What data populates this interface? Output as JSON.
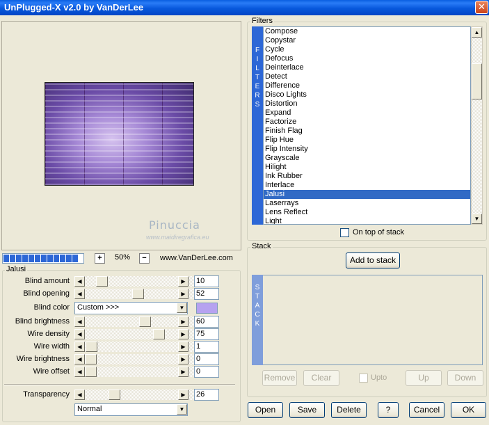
{
  "window": {
    "title": "UnPlugged-X v2.0 by VanDerLee",
    "close_glyph": "✕"
  },
  "preview": {
    "watermark_name": "Pinuccia",
    "watermark_url": "www.maidiregrafica.eu"
  },
  "zoom": {
    "plus": "+",
    "minus": "−",
    "value": "50%",
    "site": "www.VanDerLee.com",
    "progress_fraction": 1.0
  },
  "jalusi": {
    "group_label": "Jalusi",
    "params": [
      {
        "label": "Blind amount",
        "value": "10",
        "pos": 0.12
      },
      {
        "label": "Blind opening",
        "value": "52",
        "pos": 0.52
      },
      {
        "label": "Blind brightness",
        "value": "60",
        "pos": 0.6
      },
      {
        "label": "Wire density",
        "value": "75",
        "pos": 0.75
      },
      {
        "label": "Wire width",
        "value": "1",
        "pos": 0.01
      },
      {
        "label": "Wire brightness",
        "value": "0",
        "pos": 0.0
      },
      {
        "label": "Wire offset",
        "value": "0",
        "pos": 0.0
      }
    ],
    "blind_color_label": "Blind color",
    "blind_color_value": "Custom >>>",
    "blind_color_swatch": "#b6a2f0",
    "transparency": {
      "label": "Transparency",
      "value": "26",
      "pos": 0.26
    },
    "blend_mode": "Normal"
  },
  "filters": {
    "group_label": "Filters",
    "vertical_label": [
      "F",
      "I",
      "L",
      "T",
      "E",
      "R",
      "S"
    ],
    "items": [
      "Compose",
      "Copystar",
      "Cycle",
      "Defocus",
      "Deinterlace",
      "Detect",
      "Difference",
      "Disco Lights",
      "Distortion",
      "Expand",
      "Factorize",
      "Finish Flag",
      "Flip Hue",
      "Flip Intensity",
      "Grayscale",
      "Hilight",
      "Ink Rubber",
      "Interlace",
      "Jalusi",
      "Laserrays",
      "Lens Reflect",
      "Light"
    ],
    "selected": "Jalusi",
    "on_top_label": "On top of stack"
  },
  "stack": {
    "group_label": "Stack",
    "add_button": "Add to stack",
    "vertical_label": [
      "S",
      "T",
      "A",
      "C",
      "K"
    ],
    "buttons": {
      "remove": "Remove",
      "clear": "Clear",
      "upto": "Upto",
      "up": "Up",
      "down": "Down"
    }
  },
  "footer": {
    "open": "Open",
    "save": "Save",
    "delete": "Delete",
    "help": "?",
    "cancel": "Cancel",
    "ok": "OK"
  },
  "colors": {
    "accent": "#2d67d6",
    "selection": "#316ac5",
    "background": "#ece9d8"
  }
}
